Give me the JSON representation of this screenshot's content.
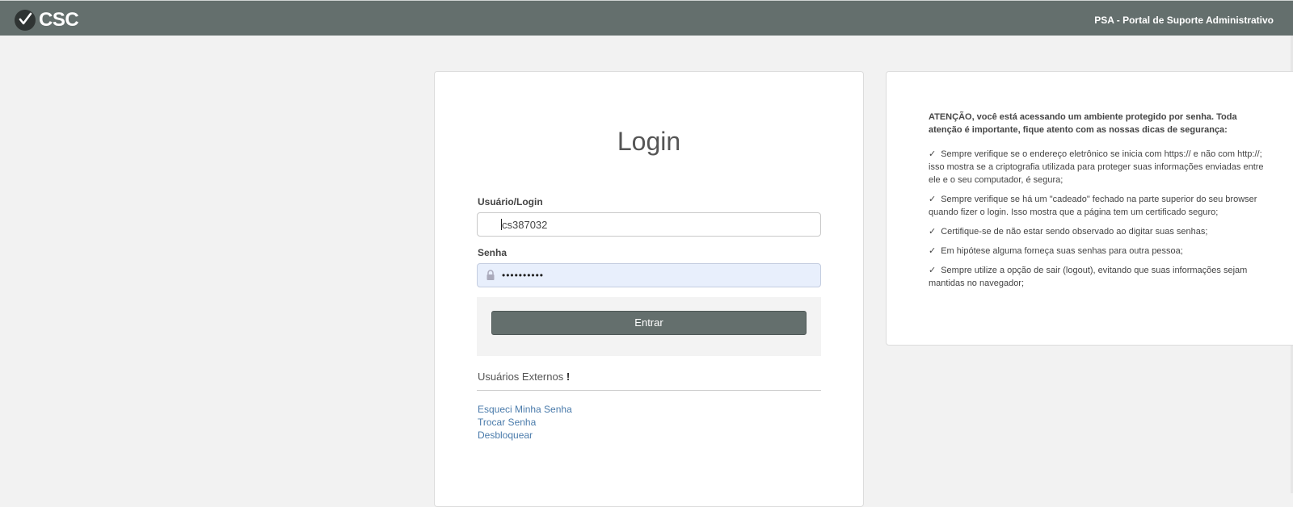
{
  "header": {
    "logo_text": "CSC",
    "portal_title": "PSA - Portal de Suporte Administrativo"
  },
  "login": {
    "title": "Login",
    "user_label": "Usuário/Login",
    "user_value": "cs387032",
    "password_label": "Senha",
    "password_masked": "••••••••••",
    "submit_label": "Entrar",
    "external_users_label": "Usuários Externos",
    "external_users_mark": "!",
    "links": [
      "Esqueci Minha Senha",
      "Trocar Senha",
      "Desbloquear"
    ]
  },
  "security_notice": {
    "heading": "ATENÇÃO, você está acessando um ambiente protegido por senha. Toda atenção é importante, fique atento com as nossas dicas de segurança:",
    "check_glyph": "✓",
    "tips": [
      "Sempre verifique se o endereço eletrônico se inicia com https:// e não com http://; isso mostra se a criptografia utilizada para proteger suas informações enviadas entre ele e o seu computador, é segura;",
      "Sempre verifique se há um \"cadeado\" fechado na parte superior do seu browser quando fizer o login. Isso mostra que a página tem um certificado seguro;",
      "Certifique-se de não estar sendo observado ao digitar suas senhas;",
      "Em hipótese alguma forneça suas senhas para outra pessoa;",
      "Sempre utilize a opção de sair (logout), evitando que suas informações sejam mantidas no navegador;"
    ]
  },
  "colors": {
    "header_bg": "#646f6d",
    "button_bg": "#646f6d",
    "link": "#4a7bab",
    "password_field_bg": "#e8effc"
  }
}
